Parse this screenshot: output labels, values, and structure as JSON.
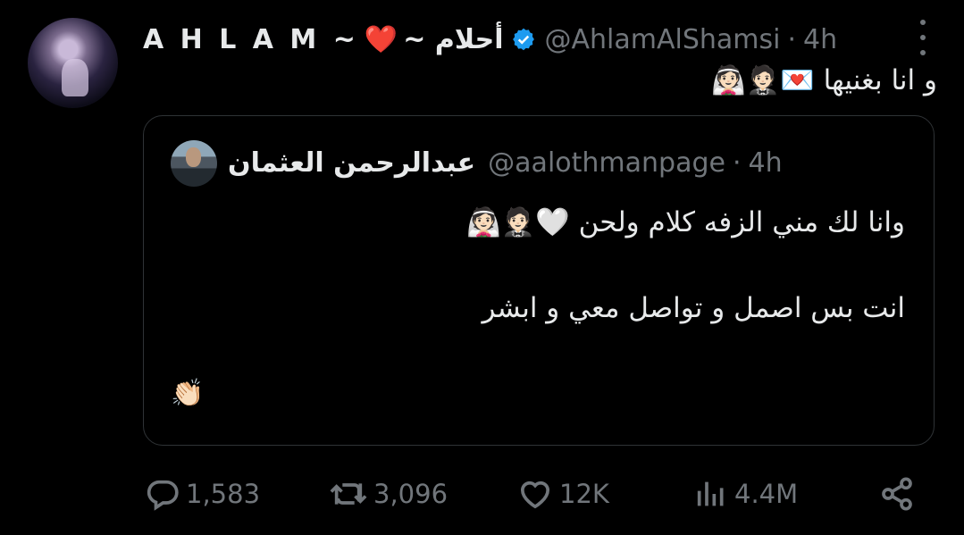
{
  "tweet": {
    "author_name": "A H L A M ~",
    "author_heart": "❤️",
    "author_name_ar": "~ أحلام",
    "handle": "@AhlamAlShamsi",
    "separator": "·",
    "time": "4h",
    "text": "و انا بغنيها 💌🤵🏻👰🏻"
  },
  "quote": {
    "author_name": "عبدالرحمن العثمان",
    "handle": "@aalothmanpage",
    "separator": "·",
    "time": "4h",
    "line1": "وانا لك مني الزفه كلام ولحن 🤍🤵🏻👰🏻",
    "line2": "انت بس اصمل و تواصل معي و ابشر",
    "line3": "👏🏻"
  },
  "actions": {
    "replies": "1,583",
    "retweets": "3,096",
    "likes": "12K",
    "views": "4.4M"
  },
  "colors": {
    "background": "#000000",
    "text": "#e7e9ea",
    "muted": "#71767b",
    "verified": "#1d9bf0",
    "border": "#2f3336"
  }
}
